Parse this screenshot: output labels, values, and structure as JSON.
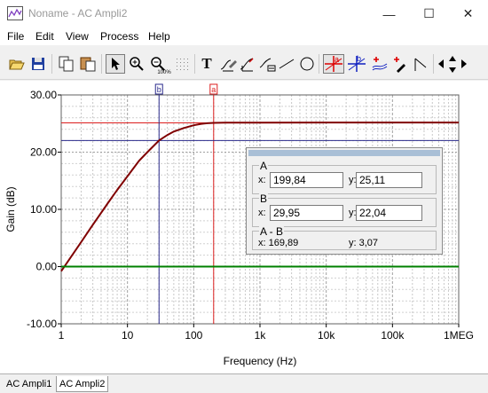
{
  "window": {
    "title": "Noname - AC Ampli2",
    "minimize": "—",
    "maximize": "☐",
    "close": "✕"
  },
  "menu": [
    "File",
    "Edit",
    "View",
    "Process",
    "Help"
  ],
  "toolbar": {
    "buttons": [
      "open-icon",
      "save-icon",
      "copy-icon",
      "paste-icon",
      "select-arrow-icon",
      "zoom-in-icon",
      "zoom-out-icon",
      "zoom-100-icon",
      "grid-icon",
      "text-tool-icon",
      "pen-icon",
      "curve-tool-icon",
      "axis-tool-icon",
      "line-tool-icon",
      "ellipse-tool-icon",
      "cursor-a-icon",
      "cursor-b-icon",
      "add-curve-icon",
      "marker-icon",
      "cursor-mode-icon",
      "arrow-left-icon",
      "arrow-up-icon",
      "arrow-down-icon",
      "arrow-right-icon"
    ],
    "zoom_100_label": "100%",
    "text_tool_label": "T",
    "cursor_a_label": "a",
    "cursor_b_label": "b"
  },
  "chart_data": {
    "type": "line",
    "xscale": "log",
    "xlim": [
      1,
      1000000
    ],
    "ylim": [
      -10,
      30
    ],
    "x_ticks": [
      "1",
      "10",
      "100",
      "1k",
      "10k",
      "100k",
      "1MEG"
    ],
    "y_ticks": [
      "30.00",
      "20.00",
      "10.00",
      "0.00",
      "-10.00"
    ],
    "xlabel": "Frequency (Hz)",
    "ylabel": "Gain (dB)",
    "grid": true,
    "series": [
      {
        "color": "#800000",
        "x": [
          1,
          2,
          3,
          5,
          7,
          10,
          15,
          20,
          30,
          40,
          50,
          70,
          100,
          130,
          160,
          199.84,
          300,
          1000,
          10000,
          100000,
          1000000
        ],
        "y": [
          -0.8,
          4.3,
          7.3,
          11.0,
          13.4,
          15.8,
          18.5,
          20.0,
          22.04,
          23.0,
          23.6,
          24.2,
          24.7,
          24.95,
          25.05,
          25.11,
          25.15,
          25.17,
          25.18,
          25.18,
          25.18
        ]
      },
      {
        "color": "#008000",
        "x": [
          1,
          1000000
        ],
        "y": [
          0,
          0
        ]
      }
    ],
    "cursors": [
      {
        "name": "a",
        "x": 199.84,
        "y": 25.11,
        "color": "#dc1e1e"
      },
      {
        "name": "b",
        "x": 29.95,
        "y": 22.04,
        "color": "#2a2a8c"
      }
    ]
  },
  "cursor_panel": {
    "a_title": "A",
    "a_x_label": "x:",
    "a_x": "199,84",
    "a_y_label": "y:",
    "a_y": "25,11",
    "b_title": "B",
    "b_x_label": "x:",
    "b_x": "29,95",
    "b_y_label": "y:",
    "b_y": "22,04",
    "diff_title": "A - B",
    "diff_x": "x:  169,89",
    "diff_y": "y: 3,07"
  },
  "tabs": [
    "AC Ampli1",
    "AC Ampli2"
  ],
  "active_tab": 1
}
